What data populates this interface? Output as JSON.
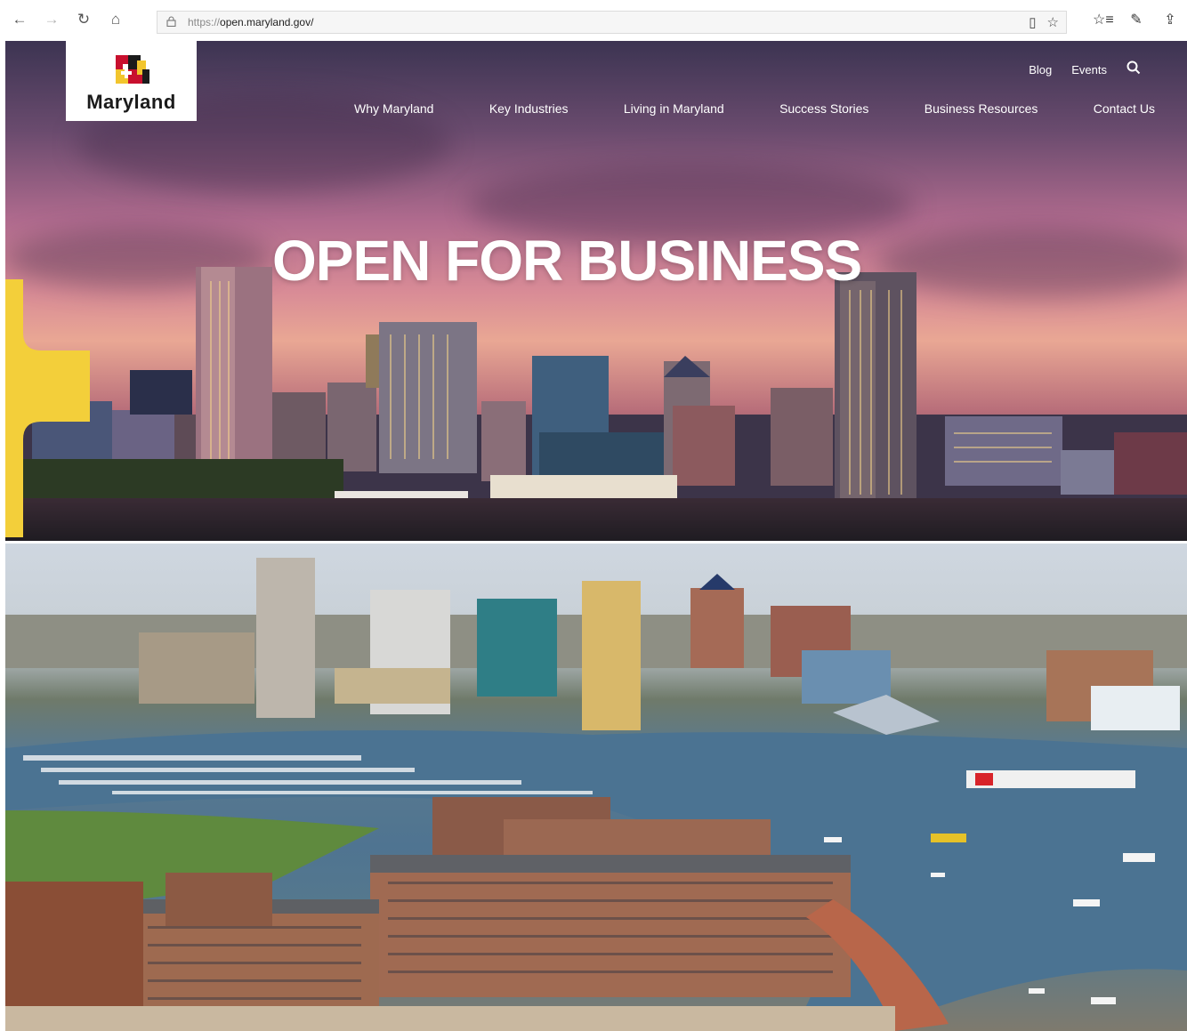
{
  "browser": {
    "back_icon": "←",
    "forward_icon": "→",
    "refresh_icon": "↻",
    "home_icon": "⌂",
    "lock_icon": "lock-icon",
    "url_scheme": "https://",
    "url_host": "open.maryland.gov/",
    "reading_icon": "▯",
    "favorite_icon": "☆",
    "favorites_bar_icon": "☆≡",
    "pen_icon": "✎",
    "share_icon": "⇪"
  },
  "site": {
    "logo_text": "Maryland",
    "utility_nav": [
      {
        "label": "Blog"
      },
      {
        "label": "Events"
      }
    ],
    "search_icon": "⌕",
    "main_nav": [
      {
        "label": "Why Maryland"
      },
      {
        "label": "Key Industries"
      },
      {
        "label": "Living in Maryland"
      },
      {
        "label": "Success Stories"
      },
      {
        "label": "Business Resources"
      },
      {
        "label": "Contact Us"
      }
    ],
    "headline": "OPEN FOR BUSINESS",
    "colors": {
      "flag_yellow": "#f2c52d",
      "flag_red": "#c8102e",
      "accent_yellow": "#f3cf3a"
    }
  }
}
